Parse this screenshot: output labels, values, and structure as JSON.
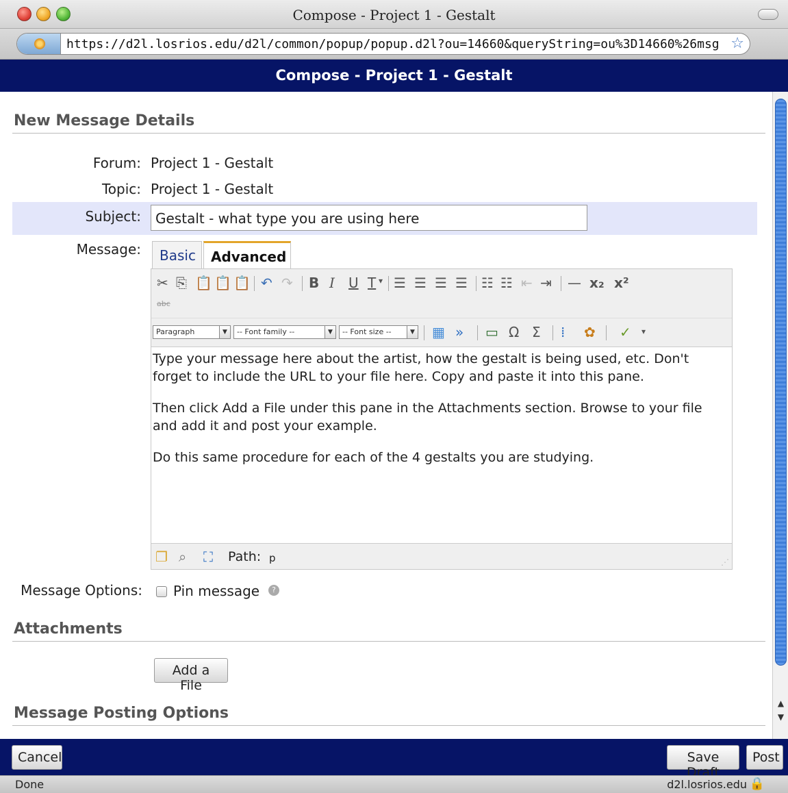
{
  "window": {
    "title": "Compose - Project 1 - Gestalt"
  },
  "browser": {
    "url": "https://d2l.losrios.edu/d2l/common/popup/popup.d2l?ou=14660&queryString=ou%3D14660%26msg",
    "status_text": "Done",
    "domain": "d2l.losrios.edu"
  },
  "page": {
    "header": "Compose - Project 1 - Gestalt"
  },
  "details": {
    "section_title": "New Message Details",
    "forum_label": "Forum:",
    "forum_value": "Project 1 - Gestalt",
    "topic_label": "Topic:",
    "topic_value": "Project 1 - Gestalt",
    "subject_label": "Subject:",
    "subject_value": "Gestalt - what type you are using here",
    "message_label": "Message:"
  },
  "editor": {
    "tabs": [
      {
        "label": "Basic"
      },
      {
        "label": "Advanced"
      }
    ],
    "format_select": "Paragraph",
    "font_family_select": "-- Font family --",
    "font_size_select": "-- Font size --",
    "paragraphs": [
      "Type your message here about the artist, how the gestalt is being used, etc. Don't forget to include the URL to your file here. Copy and paste it into this pane.",
      "Then click Add a File under this pane in the Attachments section. Browse to your file and add it and post your example.",
      "Do this same procedure for each of the 4 gestalts you are studying."
    ],
    "path_label": "Path:",
    "path_value": "p"
  },
  "options": {
    "label": "Message Options:",
    "pin_label": "Pin message"
  },
  "attachments": {
    "section_title": "Attachments",
    "add_file_label": "Add a File"
  },
  "posting": {
    "section_title": "Message Posting Options"
  },
  "footer": {
    "cancel_label": "Cancel",
    "save_draft_label": "Save Draft",
    "post_label": "Post"
  },
  "colors": {
    "header_band": "#061466",
    "subject_highlight": "#e3e6fa",
    "scroll_thumb": "#3f7ed9"
  }
}
